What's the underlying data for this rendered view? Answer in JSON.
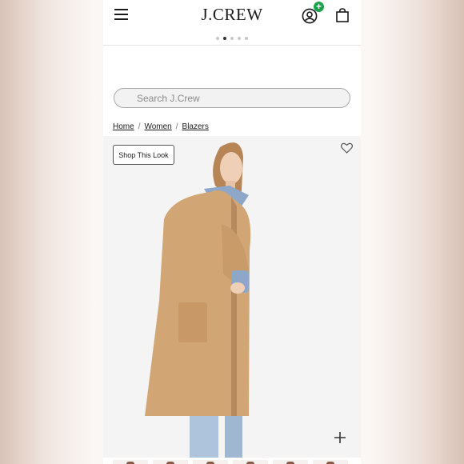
{
  "header": {
    "logo": "J.CREW",
    "menu_icon": "hamburger-menu-icon",
    "account_icon": "user-account-icon",
    "account_badge": "+",
    "bag_icon": "shopping-bag-icon"
  },
  "carousel": {
    "dot_count": 5,
    "active_index": 1
  },
  "search": {
    "placeholder": "Search J.Crew",
    "icon": "search-icon"
  },
  "breadcrumb": [
    "Home",
    "Women",
    "Blazers"
  ],
  "product": {
    "shop_look_label": "Shop This Look",
    "wishlist_icon": "heart-icon",
    "zoom_icon": "plus-icon"
  },
  "thumbnails": {
    "count": 6
  },
  "colors": {
    "brand_text": "#1a1a1a",
    "badge": "#1aa14a",
    "coat": "#d2a574",
    "background": "#ffffff"
  }
}
